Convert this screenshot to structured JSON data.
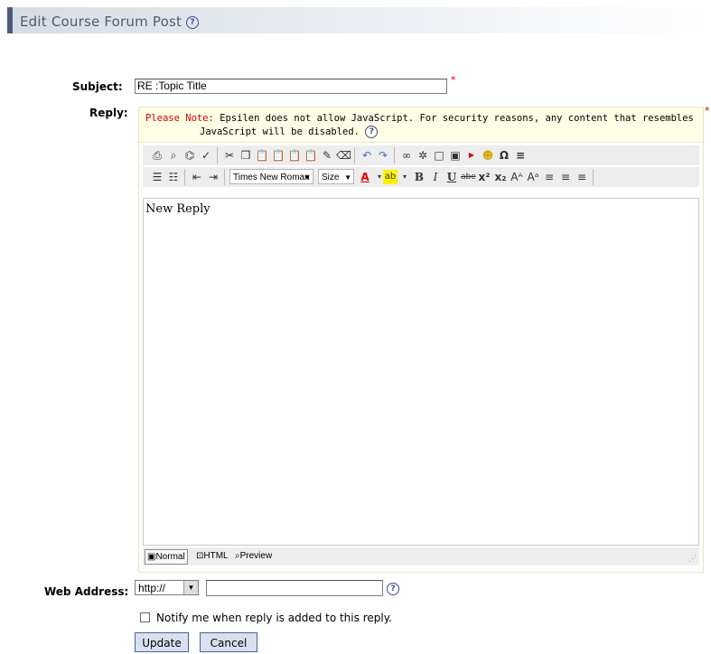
{
  "header": {
    "title": "Edit Course Forum Post"
  },
  "form": {
    "subject_label": "Subject:",
    "subject_value": "RE :Topic Title",
    "reply_label": "Reply:",
    "web_address_label": "Web Address:",
    "protocol_value": "http://",
    "web_address_value": "",
    "required_marker": "*"
  },
  "editor": {
    "note_prefix": "Please Note:",
    "note_line1": "Epsilen does not allow JavaScript. For security reasons, any content that resembles",
    "note_line2": "JavaScript will be disabled.",
    "font_family": "Times New Roman",
    "font_size": "Size",
    "content": "New Reply",
    "modes": {
      "normal": "Normal",
      "html": "HTML",
      "preview": "Preview"
    }
  },
  "notify": {
    "label": "Notify me when reply is added to this reply.",
    "checked": false
  },
  "buttons": {
    "update": "Update",
    "cancel": "Cancel"
  }
}
